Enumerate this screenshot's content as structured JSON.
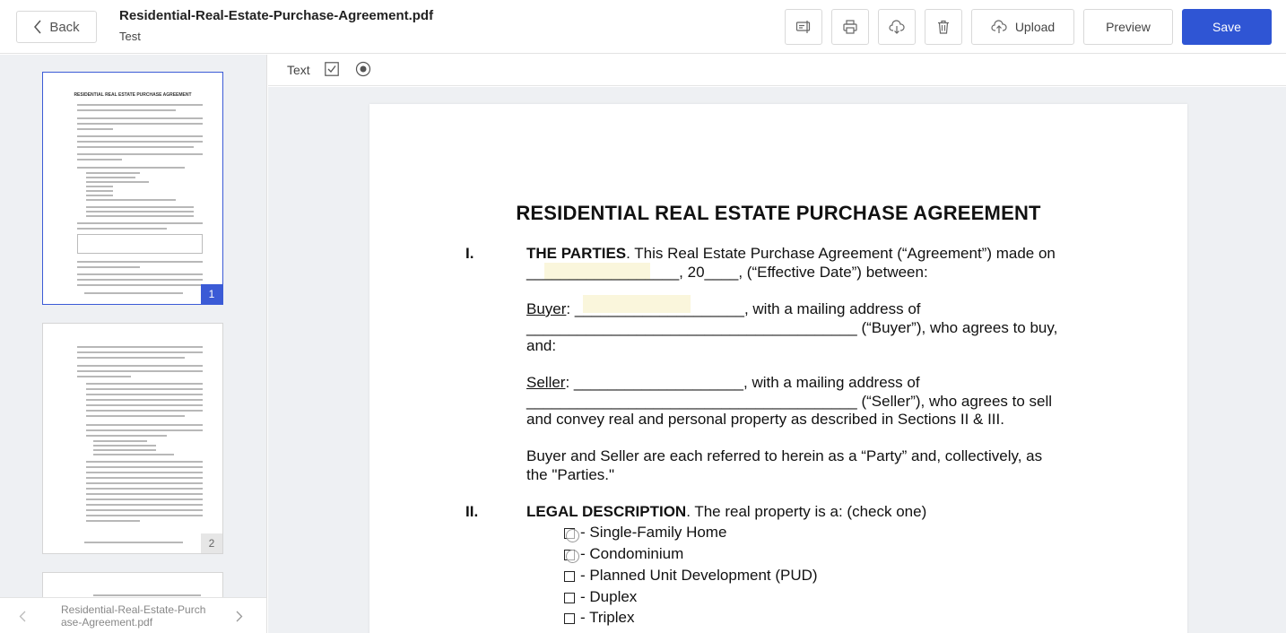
{
  "header": {
    "back_label": "Back",
    "file_title": "Residential-Real-Estate-Purchase-Agreement.pdf",
    "file_subtitle": "Test",
    "upload_label": "Upload",
    "preview_label": "Preview",
    "save_label": "Save",
    "icons": [
      "edit-fields-icon",
      "printer-icon",
      "cloud-download-icon",
      "trash-icon",
      "cloud-upload-icon"
    ],
    "accent_color": "#2f55d4"
  },
  "sidebar": {
    "thumbnails": [
      {
        "page": "1",
        "active": true,
        "mini_title": "RESIDENTIAL REAL ESTATE PURCHASE AGREEMENT"
      },
      {
        "page": "2",
        "active": false
      }
    ],
    "footer_filename": "Residential-Real-Estate-Purchase-Agreement.pdf"
  },
  "field_toolbar": {
    "text_label": "Text"
  },
  "document": {
    "title": "RESIDENTIAL REAL ESTATE PURCHASE AGREEMENT",
    "s1_num": "I.",
    "s1_heading": "THE PARTIES",
    "s1_line1": ". This Real Estate Purchase Agreement (“Agreement”) made on",
    "s1_line2": "__________________, 20____, (“Effective Date”) between:",
    "buyer_label": "Buyer",
    "buyer_line1": ": ____________________, with a mailing address of",
    "buyer_line2": "_______________________________________ (“Buyer”), who agrees to buy,",
    "buyer_line3": "and:",
    "seller_label": "Seller",
    "seller_line1": ": ____________________, with a mailing address of",
    "seller_line2": "_______________________________________ (“Seller”), who agrees to sell",
    "seller_line3": "and convey real and personal property as described in Sections II & III.",
    "parties_line1": "Buyer and Seller are each referred to herein as a “Party” and, collectively, as",
    "parties_line2": "the \"Parties.\"",
    "s2_num": "II.",
    "s2_heading": "LEGAL DESCRIPTION",
    "s2_line1": ". The real property is a: (check one)",
    "options": [
      "- Single-Family Home",
      "- Condominium",
      "- Planned Unit Development (PUD)",
      "- Duplex",
      "- Triplex"
    ]
  }
}
